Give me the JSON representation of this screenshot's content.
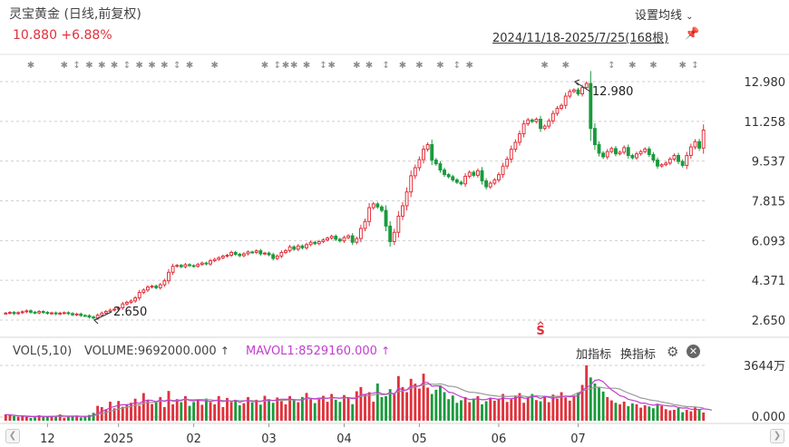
{
  "header": {
    "title": "灵宝黄金 (日线,前复权)",
    "quote": "10.880 +6.88%",
    "ma_setting": "设置均线",
    "date_range": "2024/11/18-2025/7/25(168根)"
  },
  "volume_panel": {
    "title": "VOL(5,10)",
    "volume_label": "VOLUME:9692000.000",
    "mavol_label": "MAVOL1:8529160.000",
    "add_indicator": "加指标",
    "switch_indicator": "换指标",
    "y_max_label": "3644万",
    "y_min_label": "0.000"
  },
  "colors": {
    "up": "#e0313b",
    "down": "#1a9a3c",
    "mavol1": "#c23ed0",
    "mavol2": "#999999",
    "background": "#ffffff"
  },
  "icons": {
    "ma_setting_chevron": "chevron-down-icon",
    "pin": "pin-icon",
    "settings": "gear-icon",
    "close": "close-icon",
    "scroll_left": "chevron-left-icon",
    "scroll_right": "chevron-right-icon"
  },
  "chart_data": {
    "type": "candlestick",
    "y_ticks": [
      "12.980",
      "11.258",
      "9.537",
      "7.815",
      "6.093",
      "4.371",
      "2.650"
    ],
    "ylim": [
      2.65,
      12.98
    ],
    "x_ticks": [
      "12",
      "2025",
      "02",
      "03",
      "04",
      "05",
      "06",
      "07"
    ],
    "annotations": [
      {
        "label": "12.980",
        "value": 12.98,
        "bar": 136
      },
      {
        "label": "2.650",
        "value": 2.65,
        "bar": 21
      }
    ],
    "s_marker": {
      "label": "S",
      "bar": 128
    },
    "closes": [
      2.95,
      2.98,
      2.93,
      2.97,
      3.01,
      3.05,
      2.99,
      2.96,
      3.02,
      2.98,
      2.94,
      2.96,
      2.92,
      2.95,
      2.97,
      2.93,
      2.88,
      2.91,
      2.85,
      2.84,
      2.78,
      2.74,
      2.86,
      2.95,
      3.02,
      3.08,
      3.12,
      3.18,
      3.35,
      3.42,
      3.48,
      3.61,
      3.85,
      3.95,
      4.08,
      4.12,
      4.05,
      4.18,
      4.35,
      4.72,
      4.98,
      5.02,
      4.96,
      5.05,
      5.01,
      4.98,
      5.06,
      5.12,
      5.08,
      5.22,
      5.28,
      5.35,
      5.42,
      5.46,
      5.58,
      5.5,
      5.44,
      5.52,
      5.6,
      5.58,
      5.65,
      5.52,
      5.55,
      5.48,
      5.32,
      5.42,
      5.58,
      5.66,
      5.82,
      5.72,
      5.86,
      5.78,
      5.92,
      6.02,
      5.96,
      6.05,
      6.12,
      6.2,
      6.28,
      6.15,
      6.08,
      6.22,
      6.3,
      6.02,
      6.18,
      6.62,
      6.92,
      7.52,
      7.68,
      7.55,
      7.4,
      6.72,
      6.05,
      6.45,
      7.15,
      7.6,
      8.2,
      8.9,
      9.25,
      9.6,
      10.05,
      10.25,
      9.58,
      9.42,
      9.15,
      8.95,
      8.86,
      8.72,
      8.62,
      8.55,
      8.88,
      9.05,
      8.92,
      9.12,
      8.68,
      8.42,
      8.58,
      8.72,
      8.95,
      9.32,
      9.62,
      10.05,
      10.35,
      10.72,
      11.15,
      11.32,
      11.25,
      11.35,
      10.95,
      11.05,
      11.28,
      11.6,
      11.82,
      11.95,
      12.35,
      12.55,
      12.62,
      12.45,
      12.72,
      12.9,
      10.95,
      10.25,
      9.88,
      9.72,
      9.95,
      10.08,
      9.85,
      9.92,
      10.12,
      9.78,
      9.68,
      9.85,
      9.95,
      10.06,
      9.82,
      9.58,
      9.32,
      9.38,
      9.45,
      9.62,
      9.78,
      9.52,
      9.35,
      9.78,
      10.15,
      10.38,
      10.1,
      10.88
    ],
    "volume_ylim": [
      0,
      3644
    ],
    "volume_unit": "万",
    "volumes": [
      420,
      380,
      300,
      250,
      340,
      260,
      180,
      220,
      360,
      240,
      280,
      300,
      320,
      410,
      200,
      260,
      280,
      340,
      220,
      260,
      380,
      520,
      980,
      900,
      760,
      1250,
      820,
      1300,
      920,
      1050,
      1180,
      1450,
      980,
      1820,
      1360,
      1100,
      1250,
      1560,
      900,
      1960,
      1080,
      1420,
      1220,
      1620,
      980,
      1230,
      1380,
      1050,
      1460,
      1230,
      1080,
      1620,
      900,
      1500,
      1230,
      1380,
      1020,
      1150,
      1560,
      1200,
      1380,
      1060,
      1640,
      1420,
      1180,
      1530,
      1290,
      1080,
      1620,
      1380,
      1220,
      1560,
      1830,
      1420,
      1160,
      1480,
      1640,
      1250,
      1760,
      1380,
      1240,
      1690,
      1520,
      1090,
      1940,
      2220,
      1760,
      1880,
      1250,
      2450,
      1560,
      1620,
      2080,
      1760,
      2940,
      2220,
      1880,
      2760,
      2440,
      2120,
      3100,
      2180,
      1760,
      2040,
      2320,
      1880,
      1420,
      1660,
      1180,
      1350,
      1560,
      1220,
      1460,
      1620,
      1080,
      1280,
      1520,
      1320,
      1460,
      1760,
      1240,
      1420,
      1660,
      1820,
      1180,
      1540,
      1760,
      1360,
      1280,
      1580,
      1220,
      1720,
      1460,
      1880,
      1540,
      1320,
      1620,
      1860,
      2360,
      3644,
      2850,
      2450,
      2180,
      1920,
      1560,
      1340,
      1180,
      1080,
      1260,
      960,
      1140,
      1080,
      860,
      1020,
      940,
      820,
      1120,
      980,
      760,
      680,
      720,
      840,
      560,
      720,
      620,
      880,
      760,
      540
    ],
    "mavol1": [
      400,
      380,
      350,
      310,
      310,
      290,
      270,
      260,
      290,
      280,
      280,
      290,
      300,
      330,
      310,
      300,
      300,
      300,
      290,
      280,
      300,
      340,
      480,
      610,
      710,
      870,
      930,
      1010,
      1050,
      1050,
      1100,
      1180,
      1150,
      1290,
      1360,
      1340,
      1260,
      1370,
      1270,
      1380,
      1290,
      1310,
      1320,
      1460,
      1330,
      1310,
      1370,
      1320,
      1300,
      1270,
      1320,
      1350,
      1260,
      1330,
      1270,
      1340,
      1210,
      1310,
      1330,
      1260,
      1270,
      1260,
      1370,
      1370,
      1330,
      1370,
      1420,
      1410,
      1420,
      1390,
      1360,
      1370,
      1520,
      1480,
      1440,
      1490,
      1500,
      1470,
      1540,
      1500,
      1490,
      1540,
      1520,
      1450,
      1490,
      1700,
      1730,
      1780,
      1810,
      1900,
      1780,
      1740,
      1850,
      1720,
      2160,
      2010,
      2030,
      2300,
      2280,
      2280,
      2520,
      2520,
      2270,
      2290,
      2300,
      2110,
      1880,
      1840,
      1700,
      1570,
      1490,
      1390,
      1410,
      1440,
      1380,
      1400,
      1480,
      1460,
      1390,
      1500,
      1450,
      1460,
      1480,
      1580,
      1490,
      1480,
      1600,
      1590,
      1450,
      1590,
      1550,
      1460,
      1540,
      1560,
      1620,
      1570,
      1610,
      1630,
      2010,
      2180,
      2350,
      2650,
      2700,
      2570,
      2290,
      2030,
      1860,
      1640,
      1580,
      1410,
      1350,
      1280,
      1160,
      1160,
      1070,
      1020,
      1070,
      1030,
      1000,
      960,
      960,
      870,
      830,
      840,
      750,
      740,
      740,
      780,
      760,
      700
    ],
    "mavol2": [
      400,
      390,
      360,
      330,
      320,
      310,
      300,
      290,
      290,
      290,
      280,
      280,
      280,
      290,
      290,
      290,
      300,
      300,
      290,
      290,
      300,
      330,
      410,
      470,
      530,
      620,
      700,
      770,
      830,
      900,
      940,
      1010,
      1050,
      1150,
      1200,
      1210,
      1230,
      1310,
      1310,
      1380,
      1330,
      1340,
      1370,
      1400,
      1380,
      1380,
      1390,
      1400,
      1390,
      1380,
      1340,
      1360,
      1330,
      1320,
      1300,
      1330,
      1320,
      1310,
      1320,
      1320,
      1290,
      1290,
      1310,
      1340,
      1330,
      1330,
      1340,
      1350,
      1380,
      1370,
      1380,
      1390,
      1460,
      1450,
      1420,
      1440,
      1450,
      1480,
      1500,
      1500,
      1480,
      1500,
      1520,
      1500,
      1510,
      1600,
      1620,
      1660,
      1690,
      1770,
      1710,
      1730,
      1790,
      1810,
      1930,
      1960,
      2030,
      2150,
      2220,
      2300,
      2360,
      2420,
      2410,
      2390,
      2430,
      2370,
      2270,
      2260,
      2200,
      2080,
      1960,
      1880,
      1870,
      1830,
      1780,
      1720,
      1670,
      1640,
      1600,
      1620,
      1590,
      1610,
      1610,
      1630,
      1610,
      1580,
      1610,
      1650,
      1610,
      1610,
      1590,
      1590,
      1610,
      1590,
      1620,
      1620,
      1710,
      1850,
      1930,
      2070,
      2110,
      2200,
      2210,
      2170,
      2140,
      2140,
      2140,
      2080,
      1940,
      1820,
      1720,
      1620,
      1500,
      1450,
      1380,
      1330,
      1300,
      1230,
      1180,
      1130,
      1060,
      1020,
      960,
      930,
      920,
      900,
      880,
      850
    ]
  }
}
